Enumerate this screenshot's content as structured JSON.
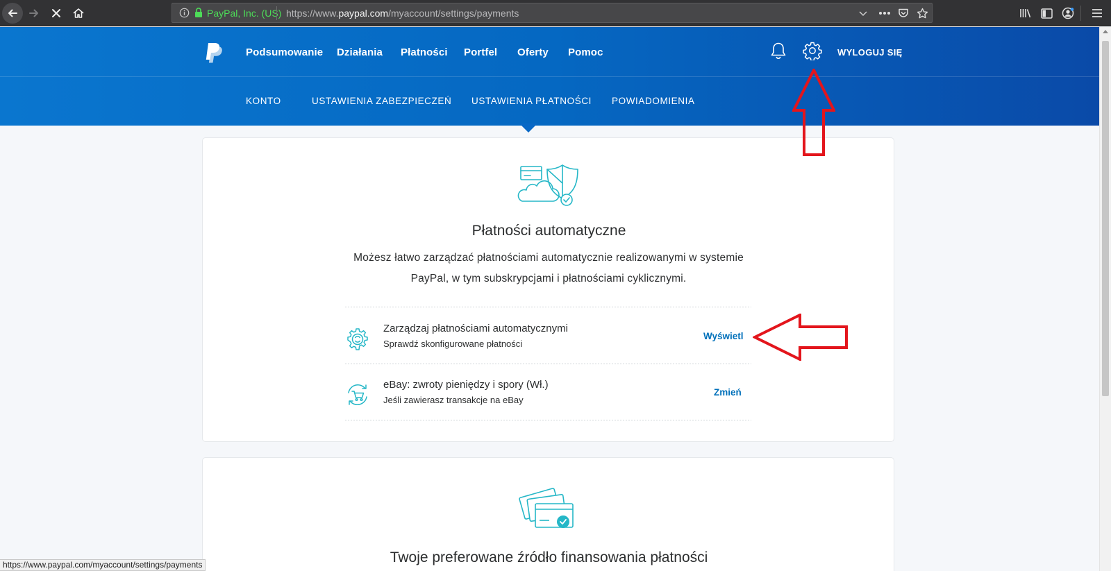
{
  "browser": {
    "site_identity": "PayPal, Inc. (US)",
    "url_prefix": "https://www.",
    "url_host": "paypal.com",
    "url_path": "/myaccount/settings/payments",
    "status_url": "https://www.paypal.com/myaccount/settings/payments",
    "icons": [
      "back-icon",
      "forward-icon",
      "stop-icon",
      "home-icon",
      "info-icon",
      "lock-icon",
      "chevron-down-icon",
      "more-icon",
      "pocket-icon",
      "star-icon",
      "library-icon",
      "sidebar-icon",
      "account-icon",
      "menu-icon"
    ]
  },
  "header": {
    "main_nav": [
      "Podsumowanie",
      "Działania",
      "Płatności",
      "Portfel",
      "Oferty",
      "Pomoc"
    ],
    "logout_label": "WYLOGUJ SIĘ",
    "sub_nav": [
      "KONTO",
      "USTAWIENIA ZABEZPIECZEŃ",
      "USTAWIENIA PŁATNOŚCI",
      "POWIADOMIENIA"
    ],
    "active_sub_nav": "USTAWIENIA PŁATNOŚCI"
  },
  "autopay_card": {
    "title": "Płatności automatyczne",
    "description": "Możesz łatwo zarządzać płatnościami automatycznie realizowanymi w systemie PayPal, w tym subskrypcjami i płatnościami cyklicznymi.",
    "rows": [
      {
        "title": "Zarządzaj płatnościami automatycznymi",
        "subtitle": "Sprawdź skonfigurowane płatności",
        "action": "Wyświetl",
        "icon": "gear-icon"
      },
      {
        "title": "eBay: zwroty pieniędzy i spory (Wł.)",
        "subtitle": "Jeśli zawierasz transakcje na eBay",
        "action": "Zmień",
        "icon": "cart-refresh-icon"
      }
    ]
  },
  "funding_card": {
    "title": "Twoje preferowane źródło finansowania płatności"
  },
  "colors": {
    "brand_blue": "#0070ba",
    "header_start": "#0a76cf",
    "header_end": "#0a4aa8",
    "accent_teal": "#25b7c7",
    "annotation_red": "#e3151c",
    "secure_green": "#4ddc58"
  }
}
